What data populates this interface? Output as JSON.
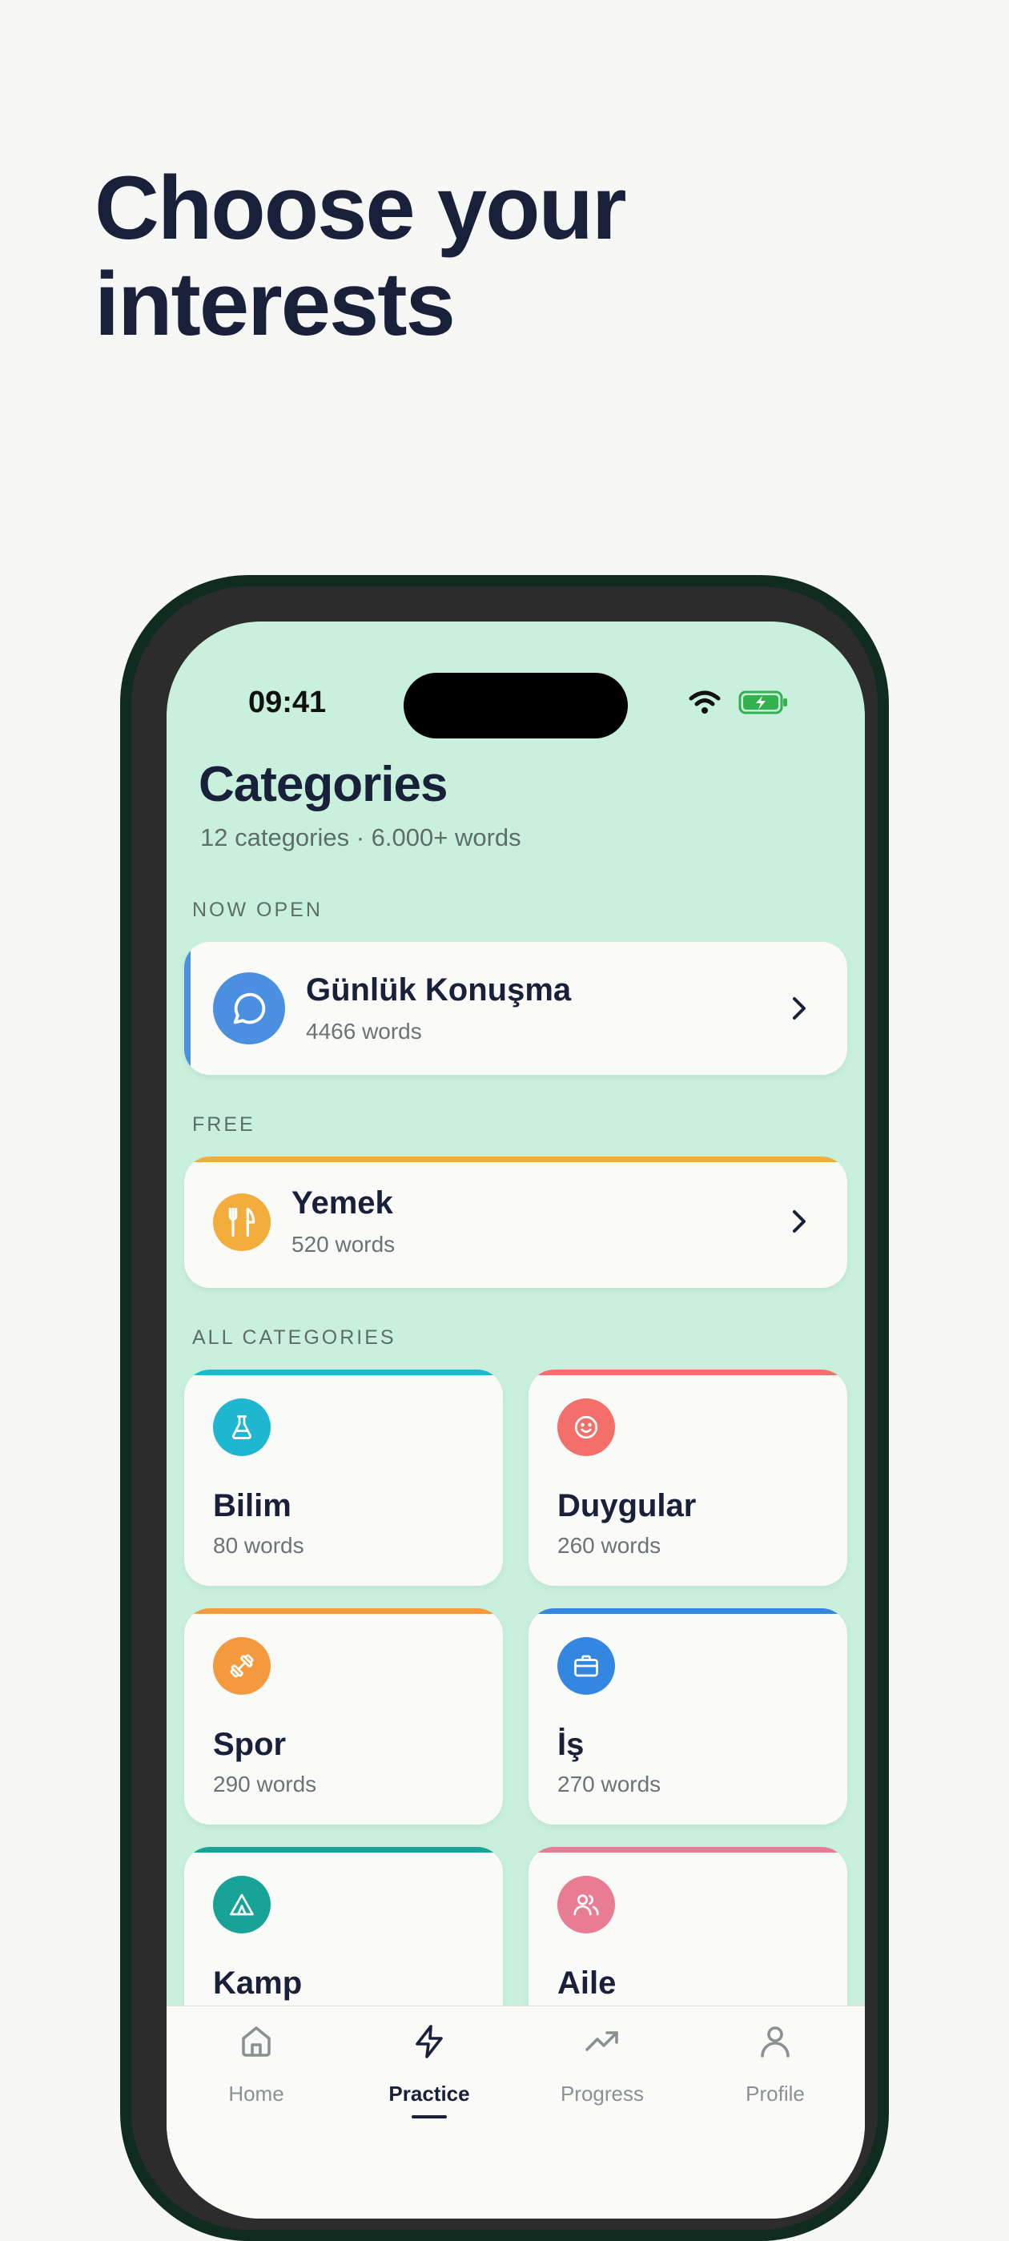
{
  "hero": {
    "title": "Choose your\ninterests"
  },
  "status_bar": {
    "time": "09:41"
  },
  "header": {
    "title": "Categories",
    "subtitle": "12 categories · 6.000+ words"
  },
  "sections": {
    "now_open": "NOW OPEN",
    "free": "FREE",
    "all": "ALL CATEGORIES"
  },
  "now_open_card": {
    "name": "Günlük Konuşma",
    "count": "4466 words",
    "icon": "chat-bubble-icon",
    "color": "#4a8fe0"
  },
  "free_card": {
    "name": "Yemek",
    "count": "520 words",
    "icon": "fork-knife-icon",
    "color": "#f2ad3d"
  },
  "categories": [
    {
      "name": "Bilim",
      "count": "80 words",
      "icon": "flask-icon",
      "color": "#1fb6cf"
    },
    {
      "name": "Duygular",
      "count": "260 words",
      "icon": "smile-icon",
      "color": "#f36f6a"
    },
    {
      "name": "Spor",
      "count": "290 words",
      "icon": "dumbbell-icon",
      "color": "#f59a3c"
    },
    {
      "name": "İş",
      "count": "270 words",
      "icon": "briefcase-icon",
      "color": "#3487e0"
    },
    {
      "name": "Kamp",
      "count": "",
      "icon": "tent-icon",
      "color": "#17a395"
    },
    {
      "name": "Aile",
      "count": "",
      "icon": "people-icon",
      "color": "#e87c93"
    }
  ],
  "tabs": [
    {
      "label": "Home",
      "icon": "home-icon",
      "active": false
    },
    {
      "label": "Practice",
      "icon": "lightning-icon",
      "active": true
    },
    {
      "label": "Progress",
      "icon": "trend-up-icon",
      "active": false
    },
    {
      "label": "Profile",
      "icon": "person-icon",
      "active": false
    }
  ]
}
